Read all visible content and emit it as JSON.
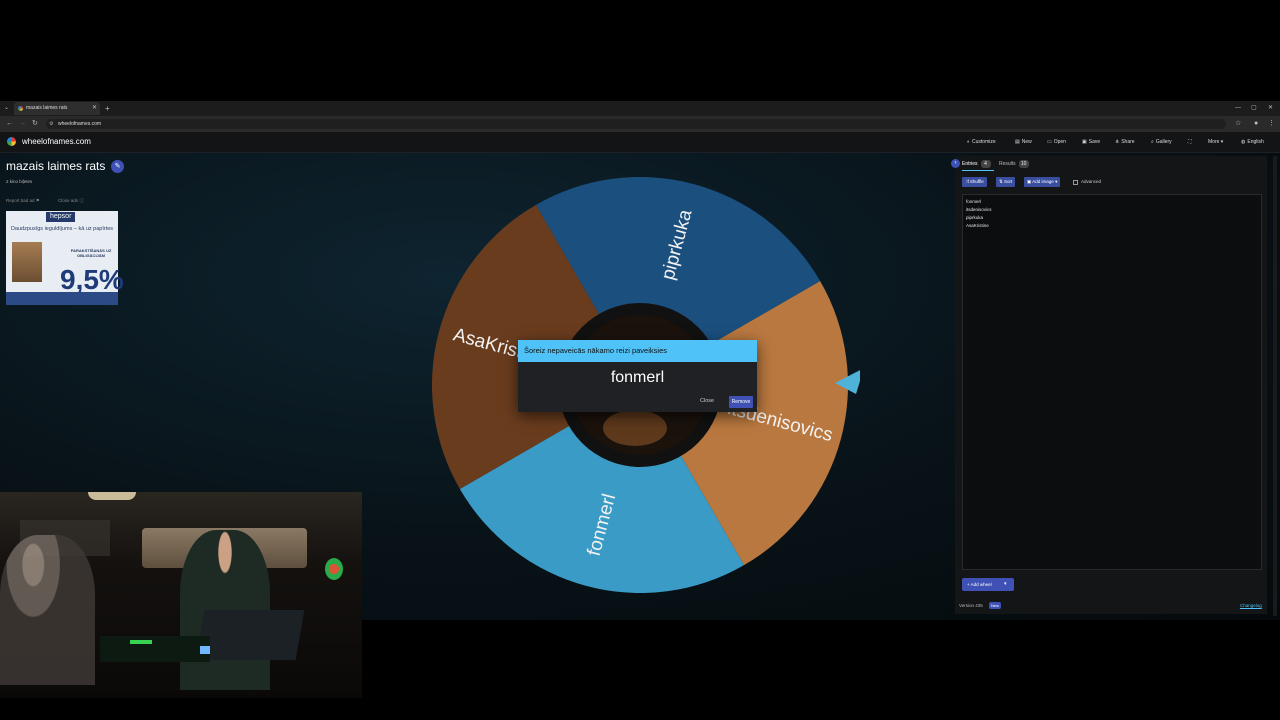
{
  "browser": {
    "tab_title": "mazais laimes rats",
    "url": "wheelofnames.com",
    "icons": {
      "back": "arrow-left-icon",
      "forward": "arrow-right-icon",
      "reload": "reload-icon"
    }
  },
  "site": {
    "logo": "wheelofnames.com",
    "header_buttons": [
      {
        "label": "Customize",
        "icon": "palette-icon",
        "glyph": "◐"
      },
      {
        "label": "New",
        "icon": "file-icon",
        "glyph": "▤"
      },
      {
        "label": "Open",
        "icon": "folder-icon",
        "glyph": "▭"
      },
      {
        "label": "Save",
        "icon": "save-icon",
        "glyph": "▣"
      },
      {
        "label": "Share",
        "icon": "share-icon",
        "glyph": "⋔"
      },
      {
        "label": "Gallery",
        "icon": "search-icon",
        "glyph": "⌕"
      },
      {
        "label": "",
        "icon": "fullscreen-icon",
        "glyph": "⛶"
      },
      {
        "label": "More ▾",
        "icon": "",
        "glyph": ""
      },
      {
        "label": "English",
        "icon": "globe-icon",
        "glyph": "◍"
      }
    ],
    "wheel_title": "mazais laimes rats",
    "subtitle": "2 kino biļetes",
    "report_bad_ad": "Report bad ad",
    "close_ads": "Close ads",
    "ad": {
      "brand": "hepsor",
      "headline": "Daudzpusīgs ieguldījums – kā uz papīrtes",
      "small": "PARAKSTĪŠANĀS UZ OBLIGĀCIJĀM",
      "rate": "9,5%"
    }
  },
  "wheel": {
    "segments": [
      {
        "label": "itsdenisovics",
        "color": "#b9783f",
        "start": -30,
        "end": 60
      },
      {
        "label": "fonmerl",
        "color": "#3a9cc6",
        "start": 60,
        "end": 150
      },
      {
        "label": "AsaKristine",
        "color": "#6a3c1e",
        "start": 150,
        "end": 240
      },
      {
        "label": "piprkuka",
        "color": "#1b4f7e",
        "start": 240,
        "end": 330
      }
    ]
  },
  "dialog": {
    "title": "Šoreiz nepaveicās nākamo reizi paveiksies",
    "winner": "fonmerl",
    "close": "Close",
    "remove": "Remove"
  },
  "panel": {
    "tabs": [
      {
        "label": "Entries",
        "count": "4"
      },
      {
        "label": "Results",
        "count": "10"
      }
    ],
    "buttons": {
      "shuffle": "Shuffle",
      "sort": "Sort",
      "add_image": "Add image"
    },
    "advanced": "Advanced",
    "entries": [
      "fonmerl",
      "itsdenisovics",
      "piprkuka",
      "AsaKristine"
    ],
    "add_wheel": "Add wheel",
    "version": "Version 435",
    "version_badge": "New",
    "changelog": "Changelog"
  }
}
